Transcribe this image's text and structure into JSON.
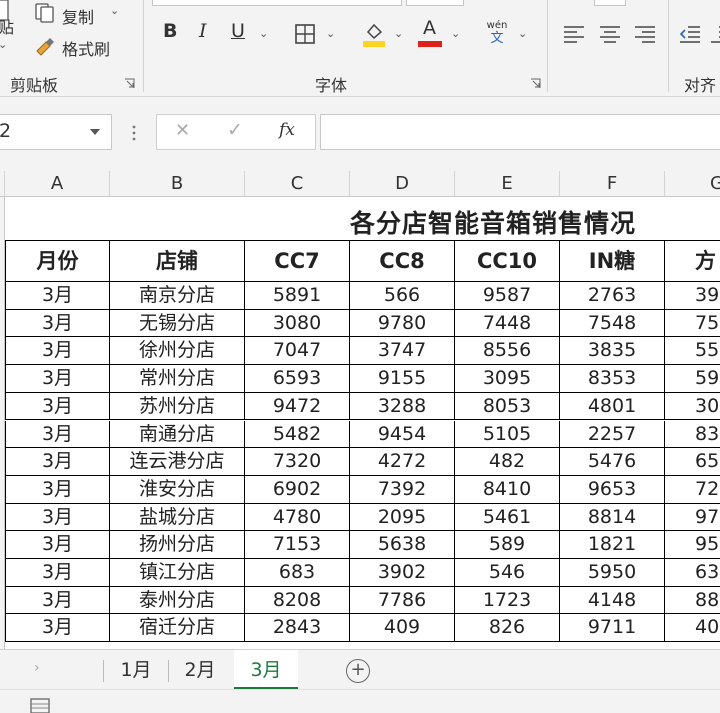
{
  "ribbon": {
    "clipboard": {
      "copy_label": "复制",
      "paste_label": "贴",
      "format_painter_label": "格式刷",
      "group_label": "剪贴板"
    },
    "font": {
      "bold": "B",
      "italic": "I",
      "underline": "U",
      "wen_top": "wén",
      "wen_bottom": "文",
      "font_color_glyph": "A",
      "fill_color": "#ffd21f",
      "font_color": "#e0201b",
      "group_label": "字体"
    },
    "alignment": {
      "group_label": "对齐"
    }
  },
  "formula_bar": {
    "name_box": "2",
    "cancel": "✕",
    "confirm": "✓",
    "fx": "fx"
  },
  "columns": [
    "A",
    "B",
    "C",
    "D",
    "E",
    "F",
    "G"
  ],
  "sheet_title": "各分店智能音箱销售情况",
  "table": {
    "headers": [
      "月份",
      "店铺",
      "CC7",
      "CC8",
      "CC10",
      "IN糖",
      "方"
    ],
    "rows": [
      [
        "3月",
        "南京分店",
        "5891",
        "566",
        "9587",
        "2763",
        "39"
      ],
      [
        "3月",
        "无锡分店",
        "3080",
        "9780",
        "7448",
        "7548",
        "75"
      ],
      [
        "3月",
        "徐州分店",
        "7047",
        "3747",
        "8556",
        "3835",
        "55"
      ],
      [
        "3月",
        "常州分店",
        "6593",
        "9155",
        "3095",
        "8353",
        "59"
      ],
      [
        "3月",
        "苏州分店",
        "9472",
        "3288",
        "8053",
        "4801",
        "30"
      ],
      [
        "3月",
        "南通分店",
        "5482",
        "9454",
        "5105",
        "2257",
        "83"
      ],
      [
        "3月",
        "连云港分店",
        "7320",
        "4272",
        "482",
        "5476",
        "65"
      ],
      [
        "3月",
        "淮安分店",
        "6902",
        "7392",
        "8410",
        "9653",
        "72"
      ],
      [
        "3月",
        "盐城分店",
        "4780",
        "2095",
        "5461",
        "8814",
        "97"
      ],
      [
        "3月",
        "扬州分店",
        "7153",
        "5638",
        "589",
        "1821",
        "95"
      ],
      [
        "3月",
        "镇江分店",
        "683",
        "3902",
        "546",
        "5950",
        "63"
      ],
      [
        "3月",
        "泰州分店",
        "8208",
        "7786",
        "1723",
        "4148",
        "88"
      ],
      [
        "3月",
        "宿迁分店",
        "2843",
        "409",
        "826",
        "9711",
        "40"
      ]
    ]
  },
  "sheet_tabs": {
    "tabs": [
      "1月",
      "2月",
      "3月"
    ],
    "active": "3月",
    "add": "+"
  },
  "colors": {
    "accent_green": "#1d7a3e",
    "ribbon_bg": "#f3f3f3"
  }
}
